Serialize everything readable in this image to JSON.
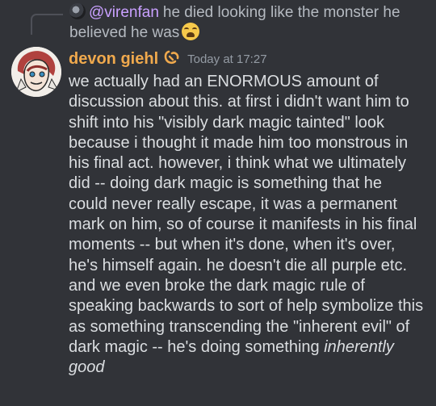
{
  "reply": {
    "author": "@virenfan",
    "text_line1": "he died looking like the monster he",
    "text_line2": "believed he was",
    "emoji": "weary-face-icon"
  },
  "message": {
    "author": "devon giehl",
    "author_color": "#f0a94d",
    "timestamp": "Today at 17:27",
    "lines": [
      "we actually had an ENORMOUS amount of",
      "discussion about this. at first i didn't want him to",
      "shift into his \"visibly dark magic tainted\" look",
      "because i thought it made him too monstrous in",
      "his final act. however, i think what we ultimately",
      "did -- doing dark magic is something that he",
      "could never really escape, it was a permanent",
      "mark on him, so of course it manifests in his final",
      "moments -- but when it's done, when it's over,",
      "he's himself again. he doesn't die all purple etc.",
      "and we even broke the dark magic rule of",
      "speaking backwards to sort of help symbolize this",
      "as something transcending the \"inherent evil\" of"
    ],
    "line14_plain": "dark magic -- he's doing something ",
    "line14_italic": "inherently",
    "line15_italic": "good"
  },
  "colors": {
    "background": "#313338",
    "text": "#dbdee1",
    "reply_author": "#c9a0ff",
    "muted": "#949ba4"
  }
}
